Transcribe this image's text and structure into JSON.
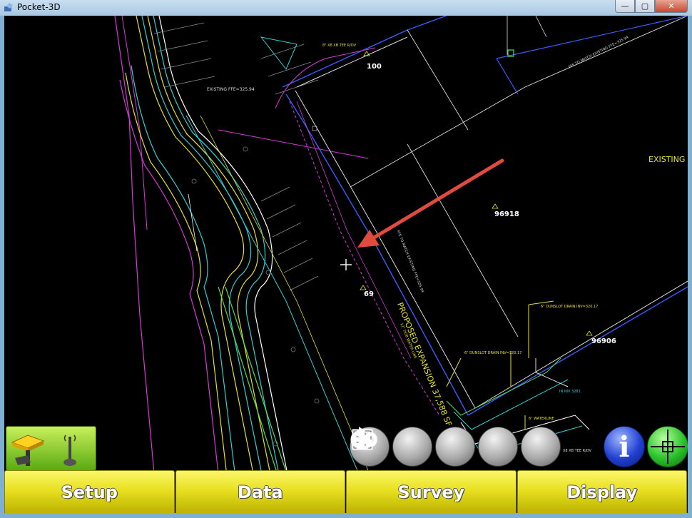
{
  "window": {
    "title": "Pocket-3D",
    "buttons": {
      "minimize": "—",
      "maximize": "▢",
      "close": "✕"
    }
  },
  "map": {
    "point_labels": [
      {
        "id": "p100",
        "text": "100"
      },
      {
        "id": "p96918",
        "text": "96918"
      },
      {
        "id": "p69",
        "text": "69"
      },
      {
        "id": "p96906",
        "text": "96906"
      }
    ],
    "annotations": {
      "existing_ffe": "EXISTING FFE=325.94",
      "proposed_expansion": "PROPOSED EXPANSION 37,588 SF",
      "ffe_to_match": "FFE TO MATCH EXISTING FFE=325.94",
      "ffe_to_match_top": "FFE TO MATCH EXISTING FFE=325.94",
      "existing_e": "EXISTING E",
      "water_line": "12\" DOB WATER LINE",
      "bound_drain_1": "6\" DUNSLOT DRAIN INV=320.17",
      "bound_drain_2": "6\" DUNSLOT DRAIN INV=320.17",
      "waterline": "6\" WATERLINE",
      "tee_top": "8\" X8 XB TEE R/DV",
      "tee_bottom": "X8 XB TEE R/DV",
      "inv_right": "IN INV 3281"
    }
  },
  "toolbar": {
    "zoom_out": "zoom-out",
    "zoom_in": "zoom-in",
    "zoom_extents": "zoom-window",
    "refresh": "refresh",
    "infinity": "infinity",
    "info_label": "i"
  },
  "menu": {
    "setup": "Setup",
    "data": "Data",
    "survey": "Survey",
    "display": "Display"
  },
  "colors": {
    "menu_yellow": "#e8e020",
    "status_green": "#7cc82a",
    "arrow_red": "#e04a3f"
  }
}
